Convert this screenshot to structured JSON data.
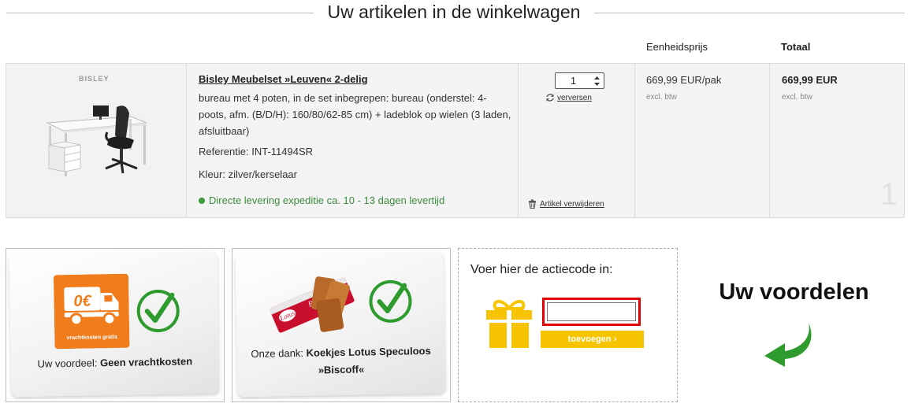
{
  "page": {
    "heading": "Uw artikelen in de winkelwagen"
  },
  "columns": {
    "unit_price": "Eenheidsprijs",
    "total": "Totaal"
  },
  "cart_item": {
    "brand": "BISLEY",
    "title": "Bisley  Meubelset »Leuven« 2-delig",
    "description": "bureau met 4 poten, in de set inbegrepen: bureau (onderstel: 4-poots, afm. (B/D/H): 160/80/62-85 cm) + ladeblok op wielen (3 laden, afsluitbaar)",
    "reference": "Referentie: INT-11494SR",
    "color": "Kleur: zilver/kerselaar",
    "delivery": "Directe levering expeditie ca. 10 - 13 dagen levertijd",
    "quantity": "1",
    "refresh_label": "verversen",
    "remove_label": "Artikel verwijderen",
    "unit_price": "669,99 EUR/pak",
    "unit_price_note": "excl. btw",
    "total": "669,99 EUR",
    "total_note": "excl. btw",
    "position": "1"
  },
  "benefits": [
    {
      "icon_text": "0€",
      "icon_caption": "vrachtkosten gratis",
      "prefix": "Uw voordeel: ",
      "value": "Geen vrachtkosten"
    },
    {
      "prefix": "Onze dank: ",
      "value_line1": "Koekjes Lotus Speculoos",
      "value_line2": "»Biscoff«",
      "pack_brand": "Lotus",
      "pack_name": "Biscoff"
    }
  ],
  "promo": {
    "label": "Voer hier de actiecode in:",
    "input_value": "",
    "button_label": "toevoegen ›"
  },
  "advantages_title": "Uw voordelen",
  "colors": {
    "accent_yellow": "#f6c400",
    "check_green": "#2e9b2e",
    "delivery_green": "#3c8a3c",
    "promo_border": "#e00000",
    "truck_orange": "#f07c1c"
  }
}
